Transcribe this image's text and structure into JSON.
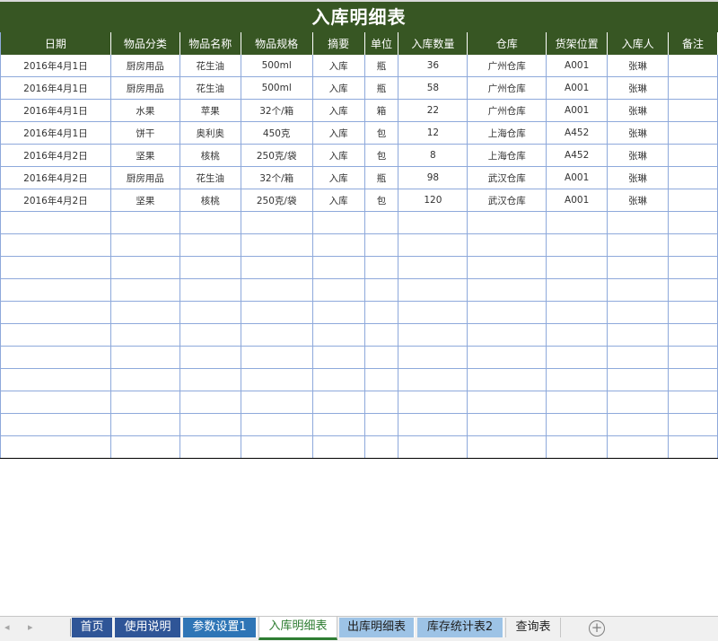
{
  "sheet": {
    "title": "入库明细表",
    "columns": [
      "日期",
      "物品分类",
      "物品名称",
      "物品规格",
      "摘要",
      "单位",
      "入库数量",
      "仓库",
      "货架位置",
      "入库人",
      "备注"
    ],
    "rows": [
      [
        "2016年4月1日",
        "厨房用品",
        "花生油",
        "500ml",
        "入库",
        "瓶",
        "36",
        "广州仓库",
        "A001",
        "张琳",
        ""
      ],
      [
        "2016年4月1日",
        "厨房用品",
        "花生油",
        "500ml",
        "入库",
        "瓶",
        "58",
        "广州仓库",
        "A001",
        "张琳",
        ""
      ],
      [
        "2016年4月1日",
        "水果",
        "苹果",
        "32个/箱",
        "入库",
        "箱",
        "22",
        "广州仓库",
        "A001",
        "张琳",
        ""
      ],
      [
        "2016年4月1日",
        "饼干",
        "奥利奥",
        "450克",
        "入库",
        "包",
        "12",
        "上海仓库",
        "A452",
        "张琳",
        ""
      ],
      [
        "2016年4月2日",
        "坚果",
        "核桃",
        "250克/袋",
        "入库",
        "包",
        "8",
        "上海仓库",
        "A452",
        "张琳",
        ""
      ],
      [
        "2016年4月2日",
        "厨房用品",
        "花生油",
        "32个/箱",
        "入库",
        "瓶",
        "98",
        "武汉仓库",
        "A001",
        "张琳",
        ""
      ],
      [
        "2016年4月2日",
        "坚果",
        "核桃",
        "250克/袋",
        "入库",
        "包",
        "120",
        "武汉仓库",
        "A001",
        "张琳",
        ""
      ]
    ],
    "empty_row_count": 11
  },
  "tabs": [
    {
      "label": "首页",
      "style": "dark"
    },
    {
      "label": "使用说明",
      "style": "dark"
    },
    {
      "label": "参数设置1",
      "style": "mid"
    },
    {
      "label": "入库明细表",
      "style": "active"
    },
    {
      "label": "出库明细表",
      "style": "light"
    },
    {
      "label": "库存统计表2",
      "style": "light"
    },
    {
      "label": "查询表",
      "style": "plain"
    }
  ],
  "add_sheet_symbol": "+",
  "nav_prev": "◂",
  "nav_next": "▸",
  "colors": {
    "header_green": "#375623",
    "grid_blue": "#8ea9db",
    "active_tab_green": "#2e7d32"
  }
}
